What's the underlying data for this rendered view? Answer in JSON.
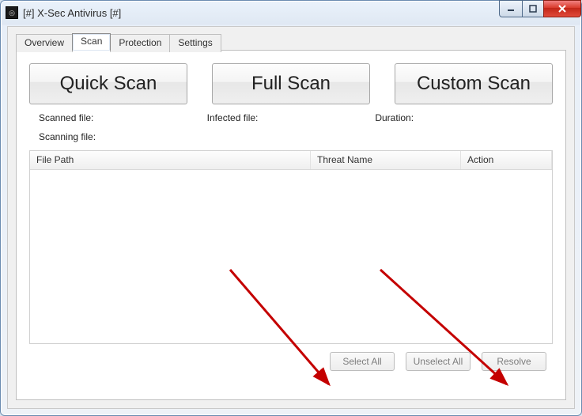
{
  "window": {
    "title": "[#] X-Sec Antivirus [#]",
    "app_icon_glyph": "◎"
  },
  "tabs": {
    "overview": "Overview",
    "scan": "Scan",
    "protection": "Protection",
    "settings": "Settings",
    "active": "scan"
  },
  "scan": {
    "quick_label": "Quick Scan",
    "full_label": "Full Scan",
    "custom_label": "Custom Scan",
    "scanned_label": "Scanned file:",
    "infected_label": "Infected file:",
    "duration_label": "Duration:",
    "scanning_label": "Scanning file:"
  },
  "grid": {
    "col_path": "File Path",
    "col_threat": "Threat Name",
    "col_action": "Action",
    "rows": []
  },
  "buttons": {
    "select_all": "Select All",
    "unselect_all": "Unselect All",
    "resolve": "Resolve"
  }
}
